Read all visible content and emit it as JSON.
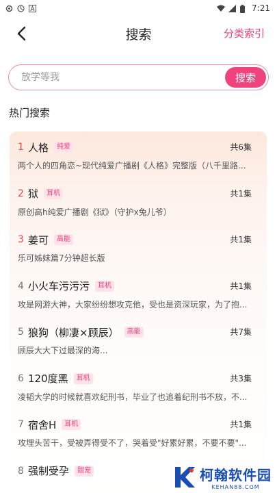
{
  "status_bar": {
    "time": "7:21",
    "icons": [
      "settings-icon",
      "target-icon",
      "a-letter-icon",
      "wifi-icon",
      "signal-icon",
      "battery-icon"
    ]
  },
  "header": {
    "title": "搜索",
    "right_link": "分类索引",
    "accent_color": "#f0407a"
  },
  "search": {
    "placeholder": "放学等我",
    "button_label": "搜索"
  },
  "hot_search": {
    "title": "热门搜索",
    "items": [
      {
        "rank": "1",
        "name": "人格",
        "tag": "纯爱",
        "count": "共6集",
        "desc": "两个人的四角恋~现代纯爱广播剧《人格》完整版（八千里路..."
      },
      {
        "rank": "2",
        "name": "狱",
        "tag": "耳机",
        "count": "共1集",
        "desc": "原创高h纯爱广播剧《狱》（守护x兔儿爷）"
      },
      {
        "rank": "3",
        "name": "姜可",
        "tag": "高能",
        "count": "共1集",
        "desc": "乐可姊妹篇7分钟超长版"
      },
      {
        "rank": "4",
        "name": "小火车污污污",
        "tag": "耳机",
        "count": "共1集",
        "desc": "攻是网游大神，大家纷纷想攻克他，受也是资深玩家，为了抱..."
      },
      {
        "rank": "5",
        "name": "狼狗（柳凄×顾辰）",
        "tag": "高能",
        "count": "共7集",
        "desc": "顾辰大大下过最深的海..."
      },
      {
        "rank": "6",
        "name": "120度黑",
        "tag": "耳机",
        "count": "共3集",
        "desc": "凌韬大学的时候就喜欢纪刑书，毕业了也追着纪刑书不放，不..."
      },
      {
        "rank": "7",
        "name": "宿舍H",
        "tag": "耳机",
        "count": "共1集",
        "desc": "攻埋头苦干，受被弄得受不了，哭着受\"好累好累，不要不要\"..."
      },
      {
        "rank": "8",
        "name": "强制受孕",
        "tag": "甜宠",
        "count": "",
        "desc": ""
      }
    ]
  },
  "watermark": {
    "name": "柯翰软件园",
    "url": "KEHAN88.COM"
  }
}
